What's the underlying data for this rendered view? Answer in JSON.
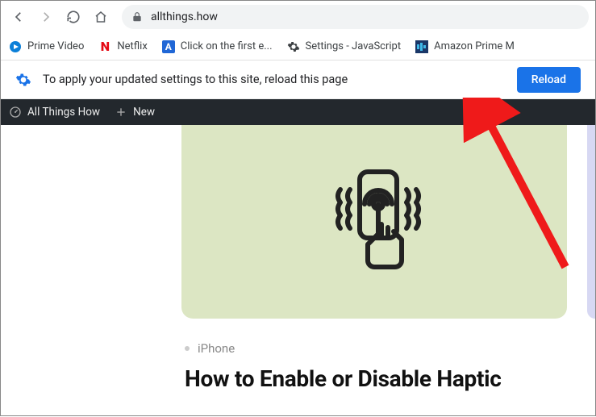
{
  "toolbar": {
    "url": "allthings.how"
  },
  "bookmarks": {
    "items": [
      {
        "label": "Prime Video"
      },
      {
        "label": "Netflix"
      },
      {
        "label": "Click on the first e..."
      },
      {
        "label": "Settings - JavaScript"
      },
      {
        "label": "Amazon Prime M"
      }
    ]
  },
  "infobar": {
    "message": "To apply your updated settings to this site, reload this page",
    "button": "Reload"
  },
  "wpbar": {
    "site": "All Things How",
    "new": "New"
  },
  "post": {
    "category": "iPhone",
    "title": "How to Enable or Disable Haptic"
  }
}
